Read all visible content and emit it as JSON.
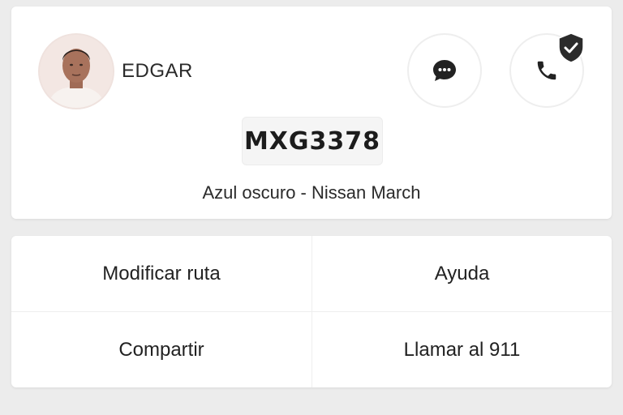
{
  "driver": {
    "name": "EDGAR",
    "photo_icon": "driver-photo"
  },
  "contact": {
    "chat_icon": "chat-bubble-icon",
    "call_icon": "phone-icon",
    "call_badge_icon": "shield-check-icon"
  },
  "vehicle": {
    "plate": "MXG3378",
    "description": "Azul oscuro - Nissan March"
  },
  "actions": [
    {
      "label": "Modificar ruta"
    },
    {
      "label": "Ayuda"
    },
    {
      "label": "Compartir"
    },
    {
      "label": "Llamar al 911"
    }
  ],
  "colors": {
    "background": "#ececec",
    "card": "#ffffff",
    "icon": "#222222",
    "plate_bg": "#f5f5f5"
  }
}
